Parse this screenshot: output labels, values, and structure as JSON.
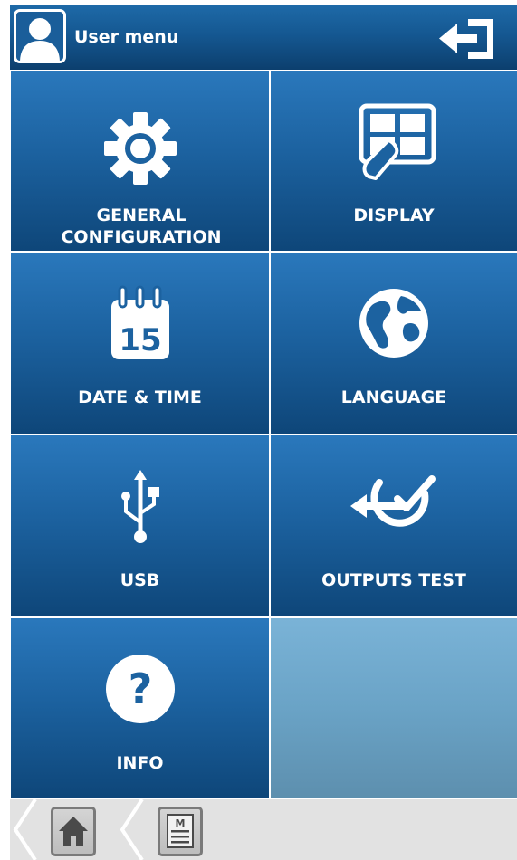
{
  "header": {
    "title": "User menu",
    "avatar_icon": "user-icon",
    "logout_icon": "logout-icon"
  },
  "tiles": [
    {
      "label": "GENERAL CONFIGURATION",
      "icon": "gear-icon"
    },
    {
      "label": "DISPLAY",
      "icon": "touch-display-icon"
    },
    {
      "label": "DATE & TIME",
      "icon": "calendar-icon",
      "icon_text": "15"
    },
    {
      "label": "LANGUAGE",
      "icon": "globe-icon"
    },
    {
      "label": "USB",
      "icon": "usb-icon"
    },
    {
      "label": "OUTPUTS TEST",
      "icon": "outputs-test-icon"
    },
    {
      "label": "INFO",
      "icon": "help-icon",
      "icon_text": "?"
    }
  ],
  "footer": {
    "home_icon": "home-icon",
    "menu_icon": "menu-icon",
    "menu_icon_text": "M"
  },
  "colors": {
    "tile_blue": "#1c62a0",
    "empty_tile": "#6aa3c6",
    "footer_bg": "#e2e2e2"
  }
}
